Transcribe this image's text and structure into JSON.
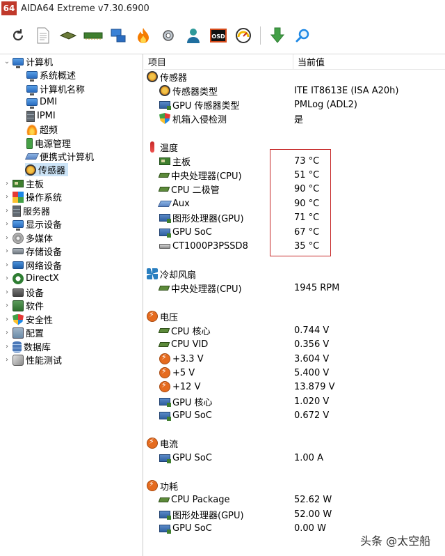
{
  "window": {
    "app_icon_label": "64",
    "title": "AIDA64 Extreme v7.30.6900"
  },
  "toolbar": {
    "buttons": [
      {
        "icon": "refresh-icon"
      },
      {
        "icon": "report-icon"
      },
      {
        "icon": "motherboard-icon"
      },
      {
        "icon": "memory-icon"
      },
      {
        "icon": "network-icon"
      },
      {
        "icon": "flame-icon"
      },
      {
        "icon": "tools-icon"
      },
      {
        "icon": "user-icon"
      },
      {
        "icon": "osd-icon",
        "label": "OSD"
      },
      {
        "icon": "gauge-icon"
      },
      {
        "icon": "download-icon"
      },
      {
        "icon": "search-icon"
      }
    ]
  },
  "tree": {
    "root": {
      "label": "计算机",
      "expanded": true
    },
    "children": [
      "系统概述",
      "计算机名称",
      "DMI",
      "IPMI",
      "超频",
      "电源管理",
      "便携式计算机",
      "传感器"
    ],
    "selected": "传感器",
    "categories": [
      "主板",
      "操作系统",
      "服务器",
      "显示设备",
      "多媒体",
      "存储设备",
      "网络设备",
      "DirectX",
      "设备",
      "软件",
      "安全性",
      "配置",
      "数据库",
      "性能测试"
    ]
  },
  "table": {
    "col_item": "项目",
    "col_value": "当前值",
    "sections": [
      {
        "title": "传感器",
        "rows": [
          {
            "label": "传感器类型",
            "value": "ITE IT8613E  (ISA A20h)"
          },
          {
            "label": "GPU 传感器类型",
            "value": "PMLog  (ADL2)"
          },
          {
            "label": "机箱入侵检测",
            "value": "是"
          }
        ]
      },
      {
        "title": "温度",
        "rows": [
          {
            "label": "主板",
            "value": "73 °C"
          },
          {
            "label": "中央处理器(CPU)",
            "value": "51 °C"
          },
          {
            "label": "CPU 二极管",
            "value": "90 °C"
          },
          {
            "label": "Aux",
            "value": "90 °C"
          },
          {
            "label": "图形处理器(GPU)",
            "value": "71 °C"
          },
          {
            "label": "GPU SoC",
            "value": "67 °C"
          },
          {
            "label": "CT1000P3PSSD8",
            "value": "35 °C"
          }
        ]
      },
      {
        "title": "冷却风扇",
        "rows": [
          {
            "label": "中央处理器(CPU)",
            "value": "1945 RPM"
          }
        ]
      },
      {
        "title": "电压",
        "rows": [
          {
            "label": "CPU 核心",
            "value": "0.744 V"
          },
          {
            "label": "CPU VID",
            "value": "0.356 V"
          },
          {
            "label": "+3.3 V",
            "value": "3.604 V"
          },
          {
            "label": "+5 V",
            "value": "5.400 V"
          },
          {
            "label": "+12 V",
            "value": "13.879 V"
          },
          {
            "label": "GPU 核心",
            "value": "1.020 V"
          },
          {
            "label": "GPU SoC",
            "value": "0.672 V"
          }
        ]
      },
      {
        "title": "电流",
        "rows": [
          {
            "label": "GPU SoC",
            "value": "1.00 A"
          }
        ]
      },
      {
        "title": "功耗",
        "rows": [
          {
            "label": "CPU Package",
            "value": "52.62 W"
          },
          {
            "label": "图形处理器(GPU)",
            "value": "52.00 W"
          },
          {
            "label": "GPU SoC",
            "value": "0.00 W"
          }
        ]
      }
    ]
  },
  "watermark": "头条 @太空船",
  "colors": {
    "highlight_box": "#c62828",
    "selection": "#cce4f7"
  }
}
